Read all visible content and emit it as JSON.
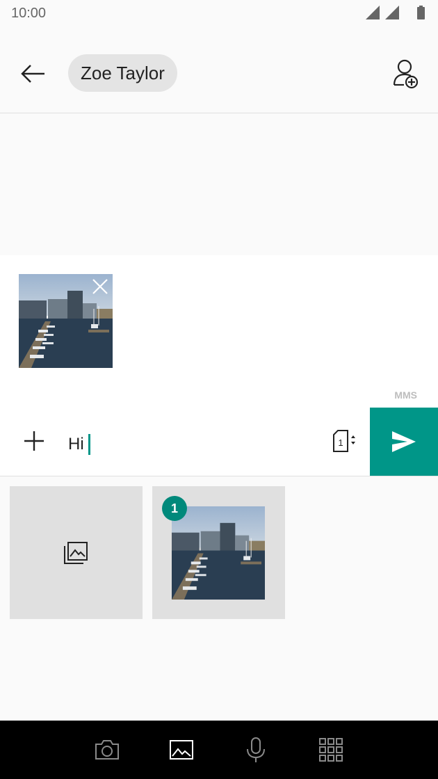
{
  "status_bar": {
    "time": "10:00",
    "icons": [
      "signal-icon",
      "signal-icon",
      "battery-icon"
    ]
  },
  "app_bar": {
    "back_icon": "arrow-left-icon",
    "contact_name": "Zoe Taylor",
    "add_contact_icon": "add-person-icon"
  },
  "compose": {
    "attachment_remove_icon": "close-icon",
    "message_type": "MMS",
    "add_icon": "plus-icon",
    "message_text": "Hi",
    "sim_icon": "sim-card-icon",
    "sim_number": "1",
    "send_icon": "send-icon"
  },
  "media_picker": {
    "gallery_icon": "photo-library-icon",
    "selected_count": "1"
  },
  "bottom_bar": {
    "tabs": [
      "camera-icon",
      "image-icon",
      "microphone-icon",
      "keypad-icon"
    ],
    "active_tab": "image-icon"
  },
  "colors": {
    "accent": "#009688",
    "badge": "#00897b",
    "background": "#fafafa",
    "tile": "#e0e0e0",
    "chip": "#e4e4e4"
  }
}
